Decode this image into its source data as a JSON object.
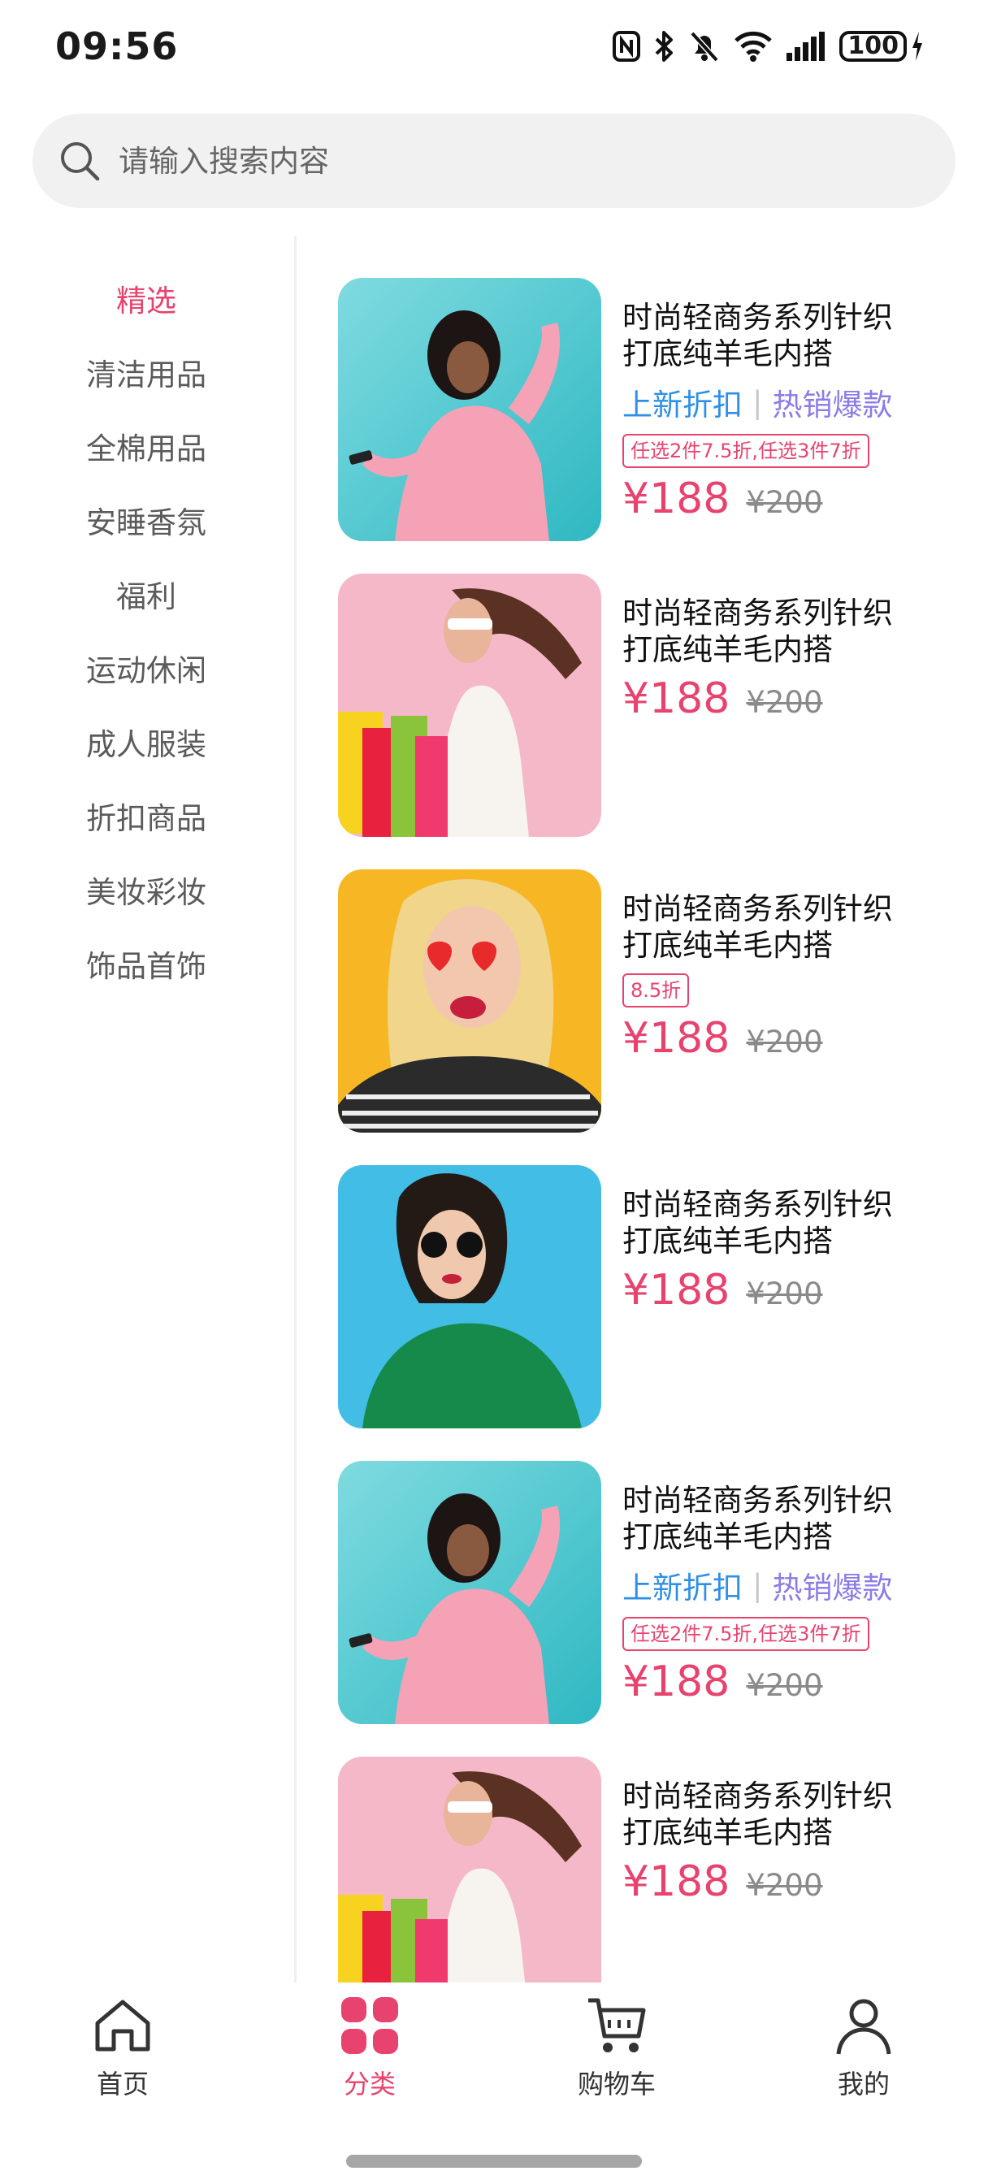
{
  "status_bar": {
    "time": "09:56",
    "battery": "100"
  },
  "search": {
    "placeholder": "请输入搜索内容"
  },
  "sidebar": {
    "items": [
      {
        "label": "精选",
        "active": true
      },
      {
        "label": "清洁用品",
        "active": false
      },
      {
        "label": "全棉用品",
        "active": false
      },
      {
        "label": "安睡香氛",
        "active": false
      },
      {
        "label": "福利",
        "active": false
      },
      {
        "label": "运动休闲",
        "active": false
      },
      {
        "label": "成人服装",
        "active": false
      },
      {
        "label": "折扣商品",
        "active": false
      },
      {
        "label": "美妆彩妆",
        "active": false
      },
      {
        "label": "饰品首饰",
        "active": false
      }
    ]
  },
  "products": [
    {
      "title_line1": "时尚轻商务系列针织",
      "title_line2": "打底纯羊毛内搭",
      "tag_new": "上新折扣",
      "tag_sep": "|",
      "tag_hot": "热销爆款",
      "promo": "任选2件7.5折,任选3件7折",
      "price": "¥188",
      "original_price": "¥200",
      "image": "woman-pink-sweater-phone"
    },
    {
      "title_line1": "时尚轻商务系列针织",
      "title_line2": "打底纯羊毛内搭",
      "price": "¥188",
      "original_price": "¥200",
      "image": "woman-shopping-bags"
    },
    {
      "title_line1": "时尚轻商务系列针织",
      "title_line2": "打底纯羊毛内搭",
      "promo": "8.5折",
      "price": "¥188",
      "original_price": "¥200",
      "image": "woman-heart-glasses"
    },
    {
      "title_line1": "时尚轻商务系列针织",
      "title_line2": "打底纯羊毛内搭",
      "price": "¥188",
      "original_price": "¥200",
      "image": "woman-sunglasses-green-shirt"
    },
    {
      "title_line1": "时尚轻商务系列针织",
      "title_line2": "打底纯羊毛内搭",
      "tag_new": "上新折扣",
      "tag_sep": "|",
      "tag_hot": "热销爆款",
      "promo": "任选2件7.5折,任选3件7折",
      "price": "¥188",
      "original_price": "¥200",
      "image": "woman-pink-sweater-phone"
    },
    {
      "title_line1": "时尚轻商务系列针织",
      "title_line2": "打底纯羊毛内搭",
      "price": "¥188",
      "original_price": "¥200",
      "image": "woman-shopping-bags"
    }
  ],
  "tabbar": {
    "tabs": [
      {
        "label": "首页",
        "icon": "home-icon",
        "active": false
      },
      {
        "label": "分类",
        "icon": "category-icon",
        "active": true
      },
      {
        "label": "购物车",
        "icon": "cart-icon",
        "active": false
      },
      {
        "label": "我的",
        "icon": "profile-icon",
        "active": false
      }
    ]
  },
  "colors": {
    "accent": "#e8436e",
    "tag_new": "#2e8fe6",
    "tag_hot": "#8d7be8"
  }
}
